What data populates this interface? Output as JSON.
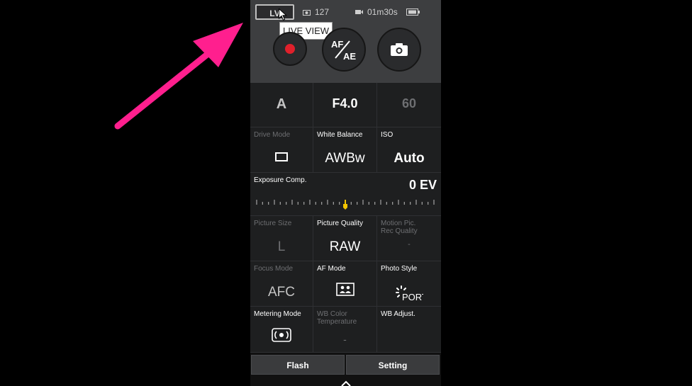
{
  "topbar": {
    "live_view_button": "LV",
    "tooltip": "LIVE VIEW",
    "remaining_shots": "127",
    "remaining_time": "01m30s"
  },
  "exposure": {
    "mode": "A",
    "aperture": "F4.0",
    "shutter": "60"
  },
  "settings": {
    "drive_mode_label": "Drive Mode",
    "white_balance_label": "White Balance",
    "white_balance_value": "AWBw",
    "iso_label": "ISO",
    "iso_value": "Auto",
    "exp_comp_label": "Exposure Comp.",
    "exp_comp_value": "0 EV",
    "picture_size_label": "Picture Size",
    "picture_size_value": "L",
    "picture_quality_label": "Picture Quality",
    "picture_quality_value": "RAW",
    "motion_label": "Motion Pic. Rec Quality",
    "motion_value": "-",
    "focus_mode_label": "Focus Mode",
    "focus_mode_value": "AFC",
    "af_mode_label": "AF Mode",
    "photo_style_label": "Photo Style",
    "photo_style_value": "PORT",
    "metering_label": "Metering Mode",
    "wb_temp_label": "WB Color Temperature",
    "wb_temp_value": "-",
    "wb_adjust_label": "WB Adjust."
  },
  "bottom": {
    "flash_label": "Flash",
    "setting_label": "Setting"
  },
  "colors": {
    "record_red": "#e0202b",
    "arrow_pink": "#ff1f8e",
    "ev_marker": "#f2c400"
  },
  "icons": [
    "pointer-arrow",
    "camera-icon",
    "battery-icon",
    "cursor-icon",
    "record-icon",
    "af-ae-icon",
    "shutter-icon",
    "drive-single-icon",
    "af-mode-icon",
    "metering-icon",
    "photo-style-icon",
    "chevron-up-icon"
  ]
}
